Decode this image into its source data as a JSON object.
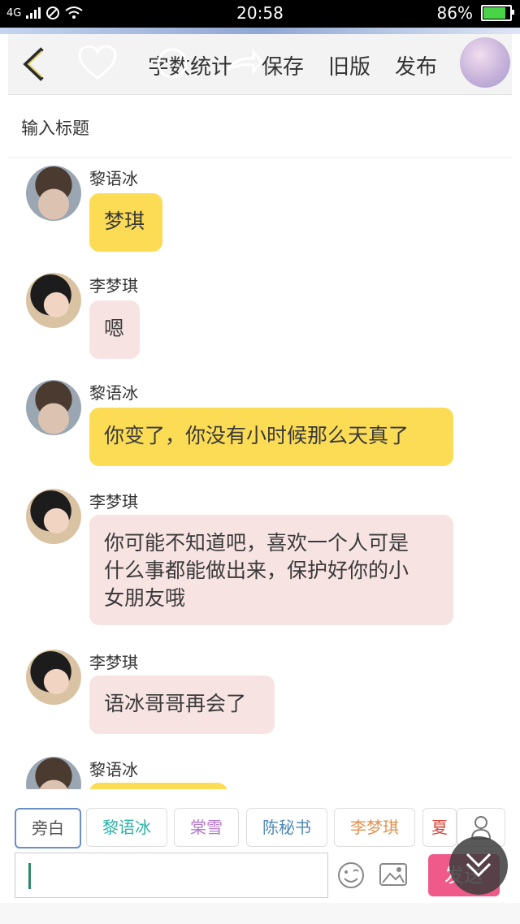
{
  "status_bar": {
    "network": "4G",
    "time": "20:58",
    "battery": "86%"
  },
  "toolbar": {
    "stats_label": "字数统计",
    "save_label": "保存",
    "old_label": "旧版",
    "publish_label": "发布"
  },
  "title_input": {
    "placeholder": "输入标题"
  },
  "messages": [
    {
      "name": "黎语冰",
      "text": "梦琪"
    },
    {
      "name": "李梦琪",
      "text": "嗯"
    },
    {
      "name": "黎语冰",
      "text": "你变了，你没有小时候那么天真了"
    },
    {
      "name": "李梦琪",
      "lines": [
        "你可能不知道吧，喜欢一个人可是",
        "什么事都能做出来，保护好你的小",
        "女朋友哦"
      ]
    },
    {
      "name": "李梦琪",
      "text": "语冰哥哥再会了"
    },
    {
      "name": "黎语冰",
      "text": ""
    }
  ],
  "roles": [
    "旁白",
    "黎语冰",
    "棠雪",
    "陈秘书",
    "李梦琪",
    "夏"
  ],
  "role_colors": [
    "#555555",
    "#2fb3a5",
    "#b37acc",
    "#4f8ab6",
    "#e0924f",
    "#d9473d"
  ],
  "composer": {
    "send_label": "发送"
  }
}
